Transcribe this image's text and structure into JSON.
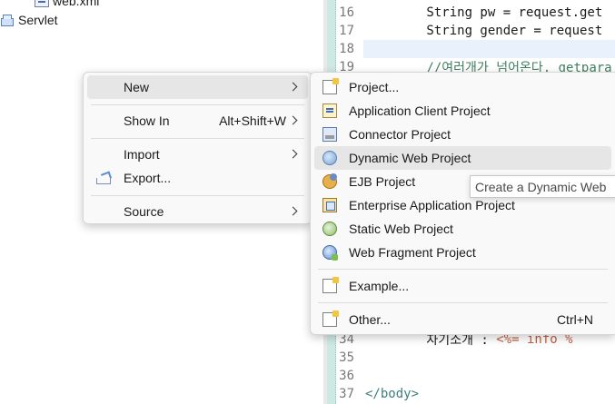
{
  "explorer": {
    "items": [
      {
        "label": "web.xml",
        "icon": "xml-file-icon"
      },
      {
        "label": "Servlet",
        "icon": "servlet-icon"
      }
    ]
  },
  "editor": {
    "lines": [
      {
        "num": "16",
        "code": "        String pw = request.get"
      },
      {
        "num": "17",
        "code": "        String gender = request"
      },
      {
        "num": "18",
        "code": ""
      },
      {
        "num": "19",
        "code": "        //여러개가 넘어온다. getpara"
      },
      {
        "num": "34",
        "code": "        자기소개 : ",
        "jsp": "<%= info %"
      },
      {
        "num": "35",
        "code": ""
      },
      {
        "num": "36",
        "code": ""
      },
      {
        "num": "37",
        "code": "</body>"
      }
    ]
  },
  "context_menu": {
    "items": [
      {
        "label": "New",
        "has_submenu": true
      },
      {
        "label": "Show In",
        "shortcut": "Alt+Shift+W",
        "has_submenu": true
      },
      {
        "label": "Import",
        "has_submenu": true
      },
      {
        "label": "Export...",
        "icon": "export-icon"
      },
      {
        "label": "Source",
        "has_submenu": true
      }
    ]
  },
  "new_submenu": {
    "items": [
      {
        "label": "Project...",
        "icon": "new-project-icon"
      },
      {
        "label": "Application Client Project",
        "icon": "application-client-project-icon"
      },
      {
        "label": "Connector Project",
        "icon": "connector-project-icon"
      },
      {
        "label": "Dynamic Web Project",
        "icon": "dynamic-web-project-icon"
      },
      {
        "label": "EJB Project",
        "icon": "ejb-project-icon"
      },
      {
        "label": "Enterprise Application Project",
        "icon": "enterprise-application-project-icon"
      },
      {
        "label": "Static Web Project",
        "icon": "static-web-project-icon"
      },
      {
        "label": "Web Fragment Project",
        "icon": "web-fragment-project-icon"
      },
      {
        "label": "Example...",
        "icon": "example-icon"
      },
      {
        "label": "Other...",
        "shortcut": "Ctrl+N",
        "icon": "other-icon"
      }
    ]
  },
  "tooltip": {
    "text": "Create a Dynamic Web"
  },
  "colors": {
    "menu_background": "#f9f9f9",
    "hover_background": "#e6e6e6",
    "editor_line_highlight": "#e8f1fc",
    "comment": "#3f7f5f",
    "jsp_tag": "#bf5f3f"
  }
}
